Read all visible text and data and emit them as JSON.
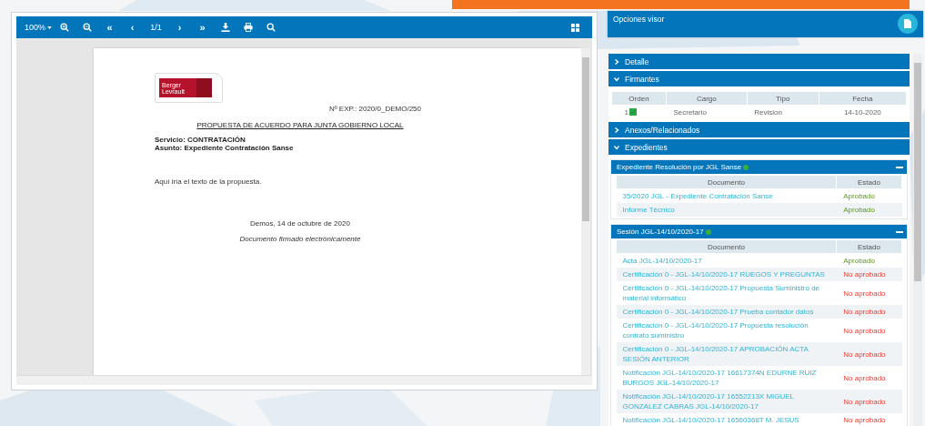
{
  "toolbar": [
    {
      "kind": "zoom",
      "label": "100%"
    },
    {
      "kind": "zoom-in"
    },
    {
      "kind": "zoom-out"
    },
    {
      "kind": "text",
      "label": "«"
    },
    {
      "kind": "text",
      "label": "‹"
    },
    {
      "kind": "page",
      "label": "1/1"
    },
    {
      "kind": "text",
      "label": "›"
    },
    {
      "kind": "text",
      "label": "»"
    },
    {
      "kind": "download"
    },
    {
      "kind": "print"
    },
    {
      "kind": "search"
    }
  ],
  "toolbar_right": {
    "kind": "grid"
  },
  "document": {
    "logo_lines": [
      "Berger",
      "Levrault"
    ],
    "exp_number": "Nº EXP.: 2020/0_DEMO/250",
    "title": "PROPUESTA DE ACUERDO PARA JUNTA GOBIERNO LOCAL",
    "fields": [
      "Servicio: CONTRATACIÓN",
      "Asunto: Expediente Contratación Sanse"
    ],
    "body": "Aquí iría el texto de la propuesta.",
    "date": "Demos, 14 de octubre de 2020",
    "signature": "Documento firmado electrónicamente"
  },
  "options": {
    "title": "Opciones visor"
  },
  "sections": [
    {
      "title": "Detalle",
      "expanded": false
    },
    {
      "kind": "signers",
      "title": "Firmantes",
      "expanded": true,
      "columns": [
        "Orden",
        "Cargo",
        "Tipo",
        "Fecha"
      ],
      "rows": [
        {
          "order": "1",
          "signed": true,
          "cargo": "Secretario",
          "tipo": "Revision",
          "fecha": "14-10-2020"
        }
      ]
    },
    {
      "title": "Anexos/Relacionados",
      "expanded": false
    },
    {
      "kind": "files",
      "title": "Expedientes",
      "expanded": true,
      "groups": [
        {
          "title": "Expediente Resolución por JGL Sanse",
          "color": "#3cae3c",
          "columns": [
            "Documento",
            "Estado"
          ],
          "rows": [
            {
              "document": "35/2020 JGL - Expediente Contratación Sanse",
              "status": "Aprobado",
              "approved": true
            },
            {
              "document": "Informe Técnico",
              "status": "Aprobado",
              "approved": true
            }
          ]
        },
        {
          "title": "Sesión JGL-14/10/2020-17",
          "color": "#3cae3c",
          "columns": [
            "Documento",
            "Estado"
          ],
          "rows": [
            {
              "document": "Acta JGL-14/10/2020-17",
              "status": "Aprobado",
              "approved": true
            },
            {
              "document": "Certificación 0 - JGL-14/10/2020-17 RUEGOS Y PREGUNTAS",
              "status": "No aprobado",
              "approved": false
            },
            {
              "document": "Certificación 0 - JGL-14/10/2020-17 Propuesta Suministro de material informático",
              "status": "No aprobado",
              "approved": false
            },
            {
              "document": "Certificación 0 - JGL-14/10/2020-17 Prueba contador datos",
              "status": "No aprobado",
              "approved": false
            },
            {
              "document": "Certificación 0 - JGL-14/10/2020-17 Propuesta resolución contrato suministro",
              "status": "No aprobado",
              "approved": false
            },
            {
              "document": "Certificación 0 - JGL-14/10/2020-17 APROBACIÓN ACTA SESIÓN ANTERIOR",
              "status": "No aprobado",
              "approved": false
            },
            {
              "document": "Notificación JGL-14/10/2020-17 16617374N EDURNE RUIZ BURGOS JGL-14/10/2020-17",
              "status": "No aprobado",
              "approved": false
            },
            {
              "document": "Notificación JGL-14/10/2020-17 16552213X MIGUEL GONZALEZ CABRAS JGL-14/10/2020-17",
              "status": "No aprobado",
              "approved": false
            },
            {
              "document": "Notificación JGL-14/10/2020-17 16560368T M. JESUS",
              "status": "No aprobado",
              "approved": false
            }
          ]
        }
      ]
    }
  ]
}
